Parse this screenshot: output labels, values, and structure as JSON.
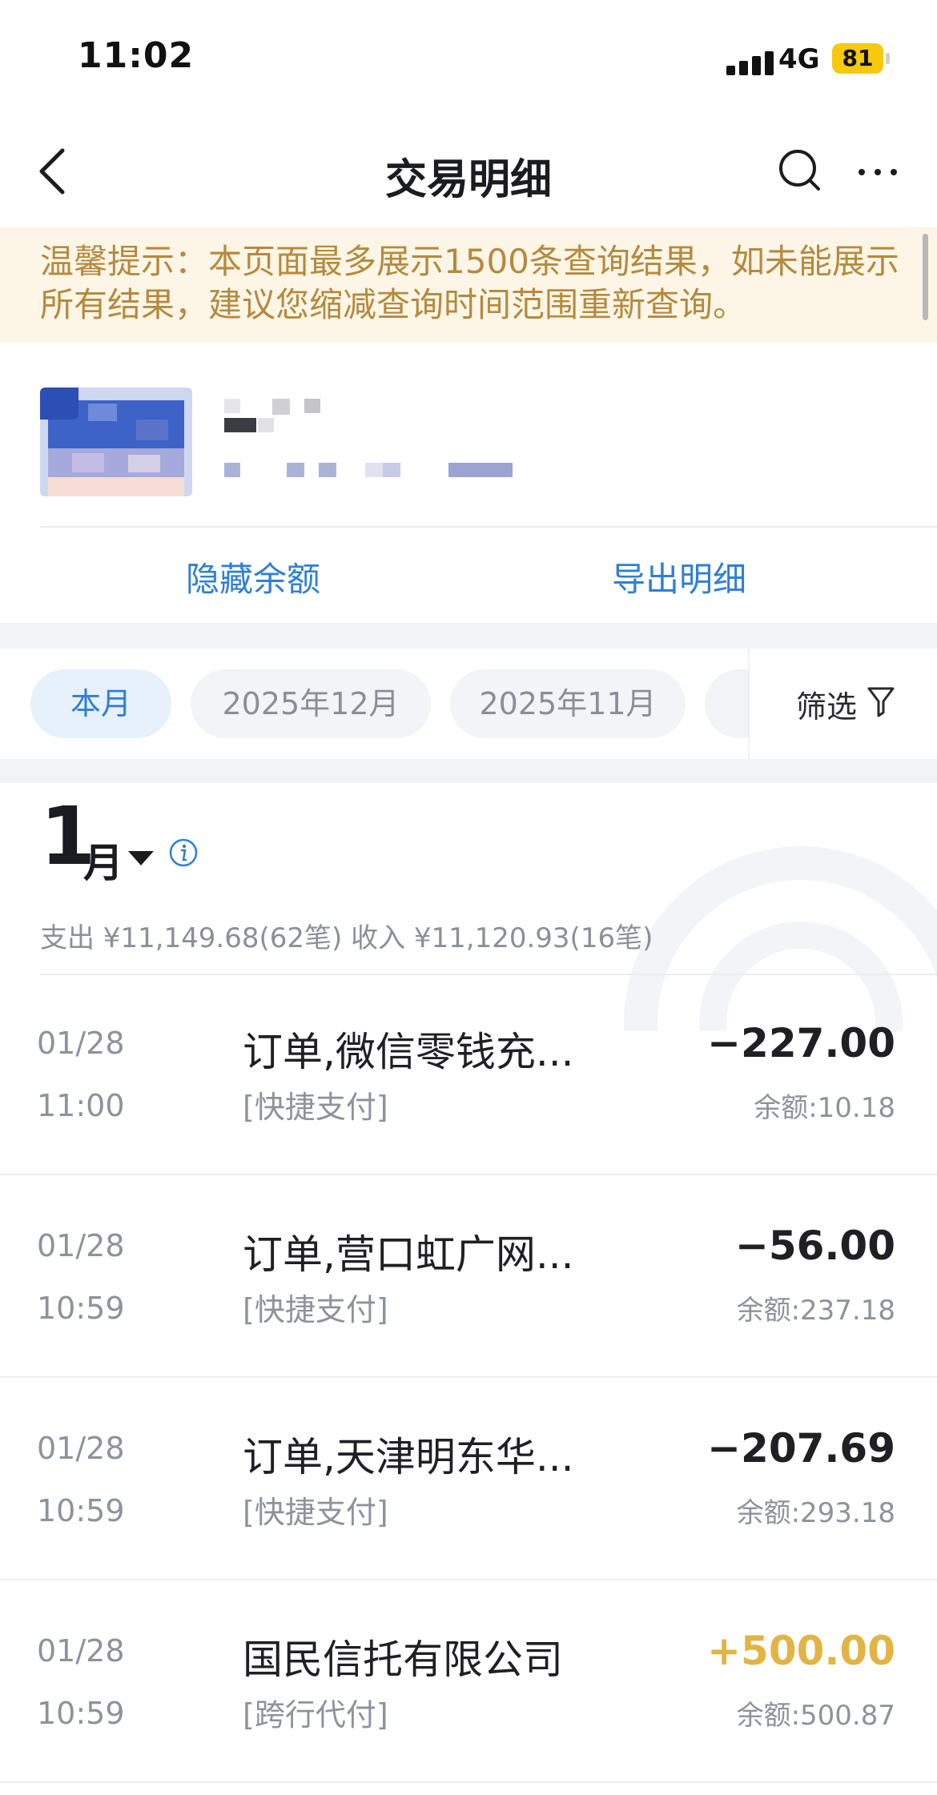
{
  "status_bar": {
    "time": "11:02",
    "network": "4G",
    "battery": "81"
  },
  "nav": {
    "title": "交易明细",
    "icons": [
      "back-icon",
      "search-icon",
      "more-icon"
    ]
  },
  "notice": {
    "text": "温馨提示：本页面最多展示1500条查询结果，如未能展示所有结果，建议您缩减查询时间范围重新查询。"
  },
  "account": {
    "actions": {
      "hide_balance": "隐藏余额",
      "export": "导出明细"
    }
  },
  "filters": {
    "chips": [
      "本月",
      "2025年12月",
      "2025年11月"
    ],
    "filter_label": "筛选"
  },
  "month": {
    "number": "1",
    "unit": "月",
    "summary": "支出 ¥11,149.68(62笔)   收入 ¥11,120.93(16笔)"
  },
  "transactions": [
    {
      "date": "01/28",
      "time": "11:00",
      "title": "订单,微信零钱充...",
      "type": "[快捷支付]",
      "amount": "−227.00",
      "balance": "余额:10.18",
      "direction": "out"
    },
    {
      "date": "01/28",
      "time": "10:59",
      "title": "订单,营口虹广网...",
      "type": "[快捷支付]",
      "amount": "−56.00",
      "balance": "余额:237.18",
      "direction": "out"
    },
    {
      "date": "01/28",
      "time": "10:59",
      "title": "订单,天津明东华...",
      "type": "[快捷支付]",
      "amount": "−207.69",
      "balance": "余额:293.18",
      "direction": "out"
    },
    {
      "date": "01/28",
      "time": "10:59",
      "title": "国民信托有限公司",
      "type": "[跨行代付]",
      "amount": "+500.00",
      "balance": "余额:500.87",
      "direction": "in"
    }
  ],
  "colors": {
    "accent": "#2e7fd8",
    "income": "#e2b444",
    "expense": "#1f1f24",
    "notice_text": "#b58a3e"
  }
}
